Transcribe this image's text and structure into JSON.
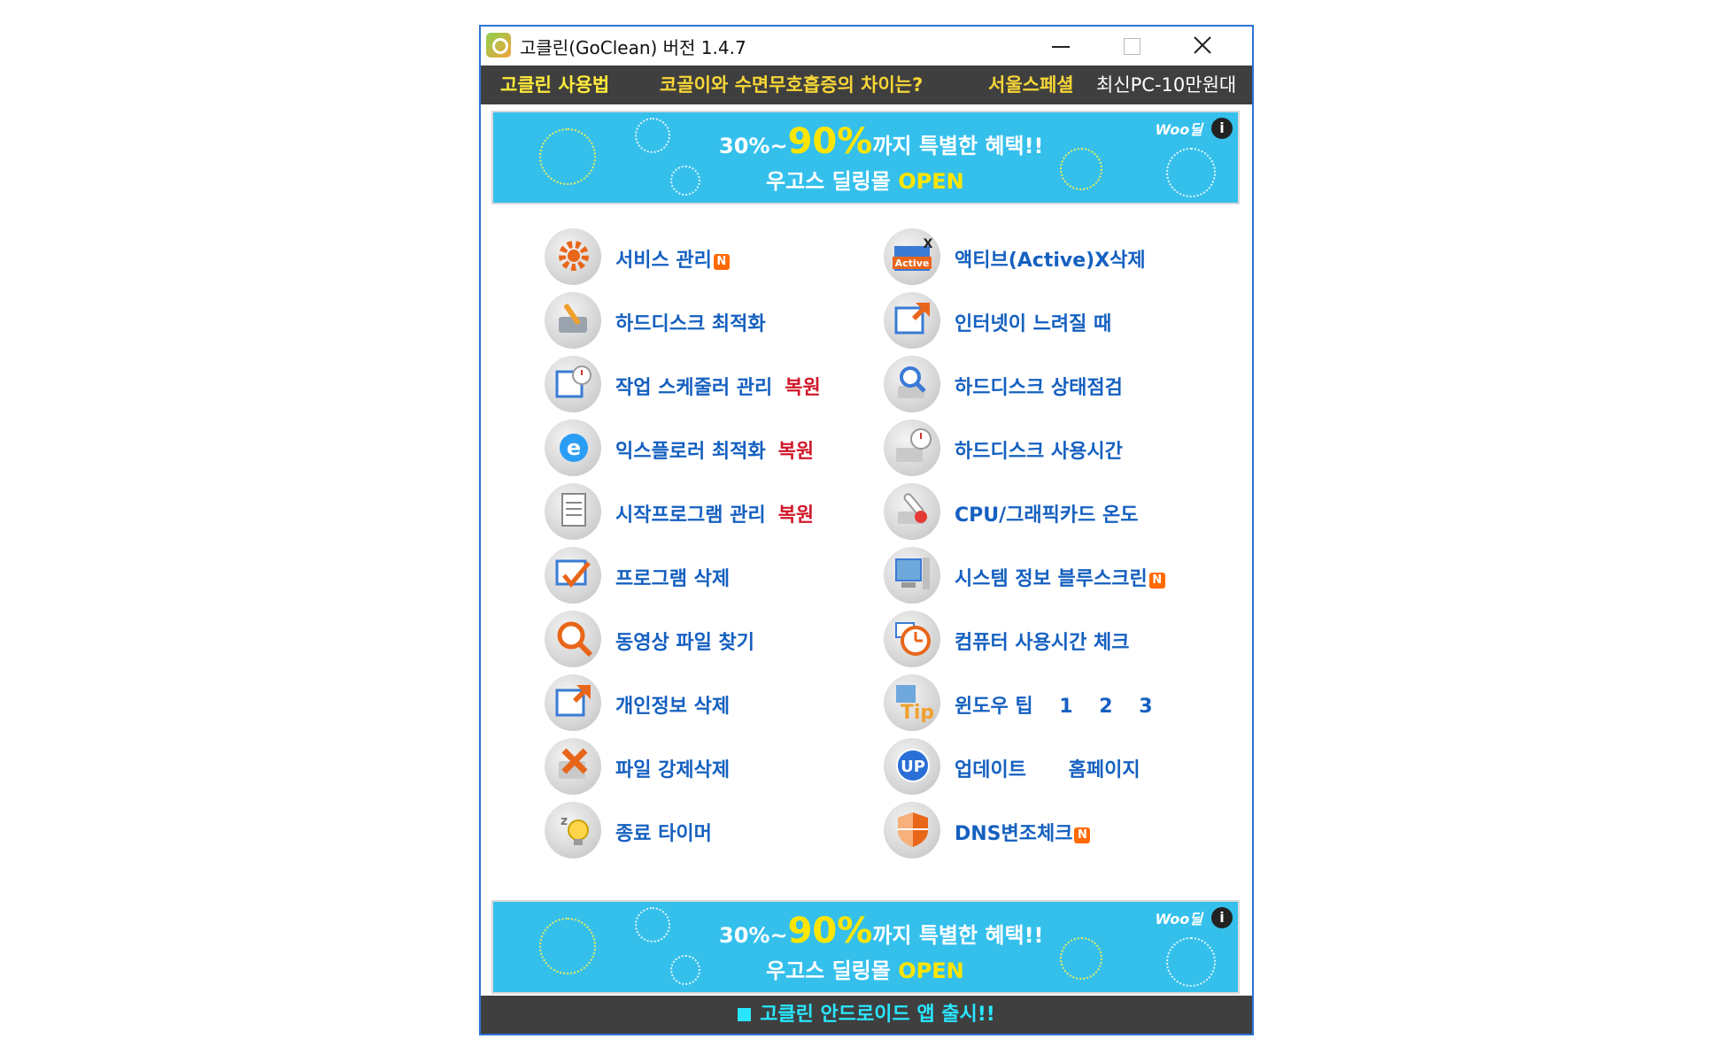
{
  "window": {
    "title": "고클린(GoClean) 버전 1.4.7",
    "minimize_glyph": "—",
    "maximize_glyph": "☐",
    "close_glyph": "✕"
  },
  "navbar": {
    "usage": "고클린 사용법",
    "news": "코골이와 수면무호흡증의 차이는?",
    "seoul": "서울스페셜",
    "pc": "최신PC-10만원대"
  },
  "banner": {
    "percent_small": "30%~",
    "percent_big": "90%",
    "benefit": "까지 특별한 혜택!!",
    "mall": "우고스 딜링몰 ",
    "open": "OPEN",
    "brand": "Woo딜",
    "info": "i"
  },
  "badge_new": "N",
  "restore_label": "복원",
  "left_items": [
    {
      "label": "서비스 관리",
      "new": true,
      "restore": false,
      "icon": "gear-icon"
    },
    {
      "label": "하드디스크 최적화",
      "new": false,
      "restore": false,
      "icon": "disk-tools-icon"
    },
    {
      "label": "작업 스케줄러 관리",
      "new": false,
      "restore": true,
      "icon": "scheduler-icon"
    },
    {
      "label": "익스플로러 최적화",
      "new": false,
      "restore": true,
      "icon": "ie-icon"
    },
    {
      "label": "시작프로그램 관리",
      "new": false,
      "restore": true,
      "icon": "document-icon"
    },
    {
      "label": "프로그램 삭제",
      "new": false,
      "restore": false,
      "icon": "checkmark-window-icon"
    },
    {
      "label": "동영상 파일 찾기",
      "new": false,
      "restore": false,
      "icon": "magnifier-icon"
    },
    {
      "label": "개인정보 삭제",
      "new": false,
      "restore": false,
      "icon": "window-arrow-icon"
    },
    {
      "label": "파일 강제삭제",
      "new": false,
      "restore": false,
      "icon": "delete-file-icon"
    },
    {
      "label": "종료 타이머",
      "new": false,
      "restore": false,
      "icon": "sleep-bulb-icon"
    }
  ],
  "right_items": [
    {
      "label": "액티브(Active)X삭제",
      "new": false,
      "icon": "activex-icon",
      "icon_text": "Active"
    },
    {
      "label": "인터넷이 느려질 때",
      "new": false,
      "icon": "browser-arrow-icon"
    },
    {
      "label": "하드디스크 상태점검",
      "new": false,
      "icon": "disk-search-icon"
    },
    {
      "label": "하드디스크 사용시간",
      "new": false,
      "icon": "disk-clock-icon"
    },
    {
      "label": "CPU/그래픽카드 온도",
      "new": false,
      "icon": "thermometer-icon"
    },
    {
      "label": "시스템 정보  블루스크린",
      "new": true,
      "icon": "computer-icon"
    },
    {
      "label": "컴퓨터 사용시간 체크",
      "new": false,
      "icon": "clock-icon"
    },
    {
      "label": "윈도우 팁",
      "new": false,
      "icon": "tip-icon",
      "icon_text": "Tip",
      "numbers": [
        "1",
        "2",
        "3"
      ]
    },
    {
      "label": "업데이트",
      "new": false,
      "icon": "update-icon",
      "icon_text": "UP",
      "extra": "홈페이지"
    },
    {
      "label": "DNS변조체크",
      "new": true,
      "icon": "shield-icon"
    }
  ],
  "footer": {
    "text": "고클린 안드로이드 앱 출시!!"
  },
  "colors": {
    "link_blue": "#1560c0",
    "restore_red": "#d0182a",
    "navbar_bg": "#3f3f3f",
    "banner_bg": "#35c0ec",
    "footer_text": "#29e6ff",
    "accent_yellow": "#f7d637"
  }
}
